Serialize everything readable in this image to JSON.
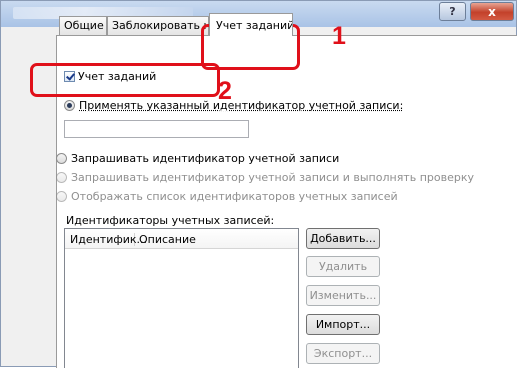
{
  "window": {
    "help_symbol": "?",
    "close_symbol": "x"
  },
  "tabs": [
    {
      "label": "Общие"
    },
    {
      "label": "Заблокировать настройки"
    },
    {
      "label": "Учет заданий"
    }
  ],
  "job_accounting": {
    "checkbox_label": "Учет заданий",
    "radio_use_specified": "Применять указанный идентификатор учетной записи:",
    "account_id_value": "",
    "radio_prompt": "Запрашивать идентификатор учетной записи",
    "radio_prompt_validate": "Запрашивать идентификатор учетной записи и выполнять проверку",
    "radio_show_list": "Отображать список идентификаторов учетных записей",
    "ids_label": "Идентификаторы учетных записей:",
    "columns": [
      "Идентифик...",
      "Описание"
    ]
  },
  "buttons": {
    "add": "Добавить...",
    "delete": "Удалить",
    "edit": "Изменить...",
    "import": "Импорт...",
    "export": "Экспорт..."
  },
  "annotations": {
    "step1": "1",
    "step2": "2",
    "color": "#e0101a"
  }
}
